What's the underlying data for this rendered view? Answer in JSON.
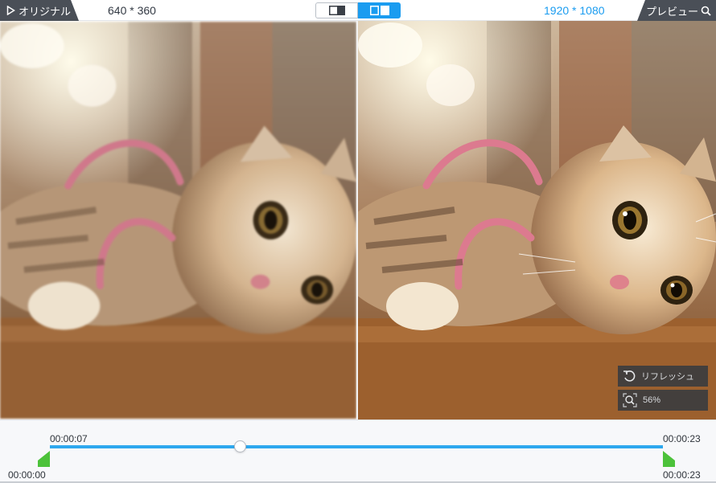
{
  "header": {
    "original_tab_label": "オリジナル",
    "original_resolution": "640 * 360",
    "output_resolution": "1920 * 1080",
    "preview_tab_label": "プレビュー",
    "active_view": "side-by-side"
  },
  "preview_tools": {
    "refresh_label": "リフレッシュ",
    "zoom_label": "56%"
  },
  "timeline": {
    "current_time": "00:00:07",
    "start_time": "00:00:00",
    "end_time_top": "00:00:23",
    "end_time_bottom": "00:00:23",
    "progress_fraction": 0.31
  },
  "colors": {
    "accent": "#1a9cf0",
    "tab_bg": "#4a4f57",
    "trim_handle": "#4cc23a"
  }
}
